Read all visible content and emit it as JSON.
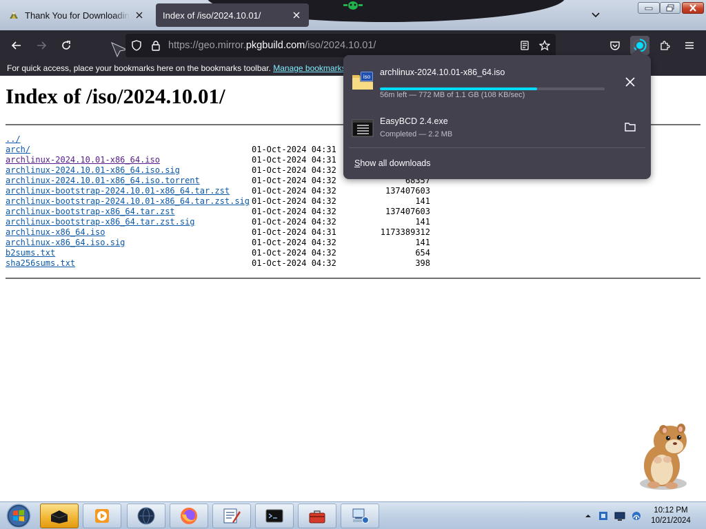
{
  "browser": {
    "tabs": [
      {
        "title": "Thank You for Downloading Ea",
        "active": false
      },
      {
        "title": "Index of /iso/2024.10.01/",
        "active": true
      }
    ],
    "url": {
      "prefix": "https://geo.mirror.",
      "host": "pkgbuild.com",
      "path": "/iso/2024.10.01/"
    },
    "bookmarks_bar": {
      "message": "For quick access, place your bookmarks here on the bookmarks toolbar.",
      "link": "Manage bookmarks..."
    }
  },
  "page": {
    "heading": "Index of /iso/2024.10.01/",
    "entries": [
      {
        "name": "../",
        "date": "",
        "size": ""
      },
      {
        "name": "arch/",
        "date": "01-Oct-2024 04:31",
        "size": ""
      },
      {
        "name": "archlinux-2024.10.01-x86_64.iso",
        "date": "01-Oct-2024 04:31",
        "size": ""
      },
      {
        "name": "archlinux-2024.10.01-x86_64.iso.sig",
        "date": "01-Oct-2024 04:32",
        "size": ""
      },
      {
        "name": "archlinux-2024.10.01-x86_64.iso.torrent",
        "date": "01-Oct-2024 04:32",
        "size": "68357"
      },
      {
        "name": "archlinux-bootstrap-2024.10.01-x86_64.tar.zst",
        "date": "01-Oct-2024 04:32",
        "size": "137407603"
      },
      {
        "name": "archlinux-bootstrap-2024.10.01-x86_64.tar.zst.sig",
        "date": "01-Oct-2024 04:32",
        "size": "141"
      },
      {
        "name": "archlinux-bootstrap-x86_64.tar.zst",
        "date": "01-Oct-2024 04:32",
        "size": "137407603"
      },
      {
        "name": "archlinux-bootstrap-x86_64.tar.zst.sig",
        "date": "01-Oct-2024 04:32",
        "size": "141"
      },
      {
        "name": "archlinux-x86_64.iso",
        "date": "01-Oct-2024 04:31",
        "size": "1173389312"
      },
      {
        "name": "archlinux-x86_64.iso.sig",
        "date": "01-Oct-2024 04:32",
        "size": "141"
      },
      {
        "name": "b2sums.txt",
        "date": "01-Oct-2024 04:32",
        "size": "654"
      },
      {
        "name": "sha256sums.txt",
        "date": "01-Oct-2024 04:32",
        "size": "398"
      }
    ]
  },
  "downloads_panel": {
    "items": [
      {
        "name": "archlinux-2024.10.01-x86_64.iso",
        "status": "56m left — 772 MB of 1.1 GB (108 KB/sec)",
        "progress": 0.7,
        "icon": "iso-file-icon"
      },
      {
        "name": "EasyBCD 2.4.exe",
        "status": "Completed — 2.2 MB",
        "icon": "exe-file-icon"
      }
    ],
    "show_all": {
      "accel": "S",
      "rest": "how all downloads"
    }
  },
  "taskbar": {
    "clock_time": "10:12 PM",
    "clock_date": "10/21/2024"
  },
  "colors": {
    "progress_fill": "#00ddff",
    "link": "#0b58a8",
    "visited_link": "#551a8b",
    "panel_bg": "#42414d",
    "toolbar_bg": "#2b2a33"
  }
}
